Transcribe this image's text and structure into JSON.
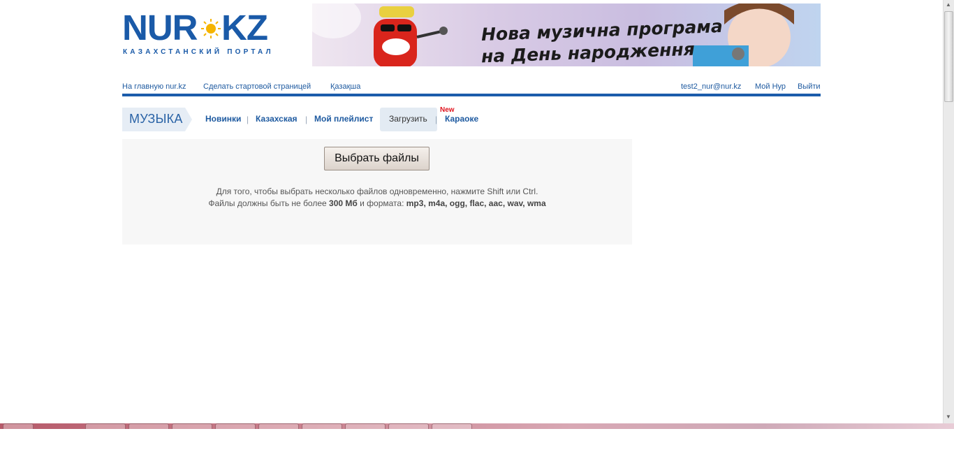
{
  "logo": {
    "main_left": "NUR",
    "main_right": "KZ",
    "subtitle": "КАЗАХСТАНСКИЙ ПОРТАЛ"
  },
  "banner": {
    "line1": "Нова музична програма",
    "line2": "на День народження"
  },
  "topnav": {
    "home": "На главную nur.kz",
    "start_page": "Сделать стартовой страницей",
    "kazakh": "Қазақша",
    "user_email": "test2_nur@nur.kz",
    "my_nur": "Мой Нур",
    "logout": "Выйти"
  },
  "music_nav": {
    "section_title": "МУЗЫКА",
    "items": [
      "Новинки",
      "Казахская",
      "Мой плейлист",
      "Загрузить",
      "Караоке"
    ],
    "separator": "|",
    "new_badge": "New"
  },
  "upload": {
    "button_label": "Выбрать файлы",
    "hint1": "Для того, чтобы выбрать несколько файлов одновременно, нажмите Shift или Ctrl.",
    "hint2_prefix": "Файлы должны быть не более ",
    "max_size": "300 Мб",
    "hint2_middle": " и формата: ",
    "formats": "mp3, m4a, ogg, flac, aac, wav, wma"
  },
  "colors": {
    "brand_blue": "#1b5cab",
    "sun_yellow": "#f5b400",
    "new_red": "#e0141e",
    "panel_bg": "#f7f7f7"
  }
}
